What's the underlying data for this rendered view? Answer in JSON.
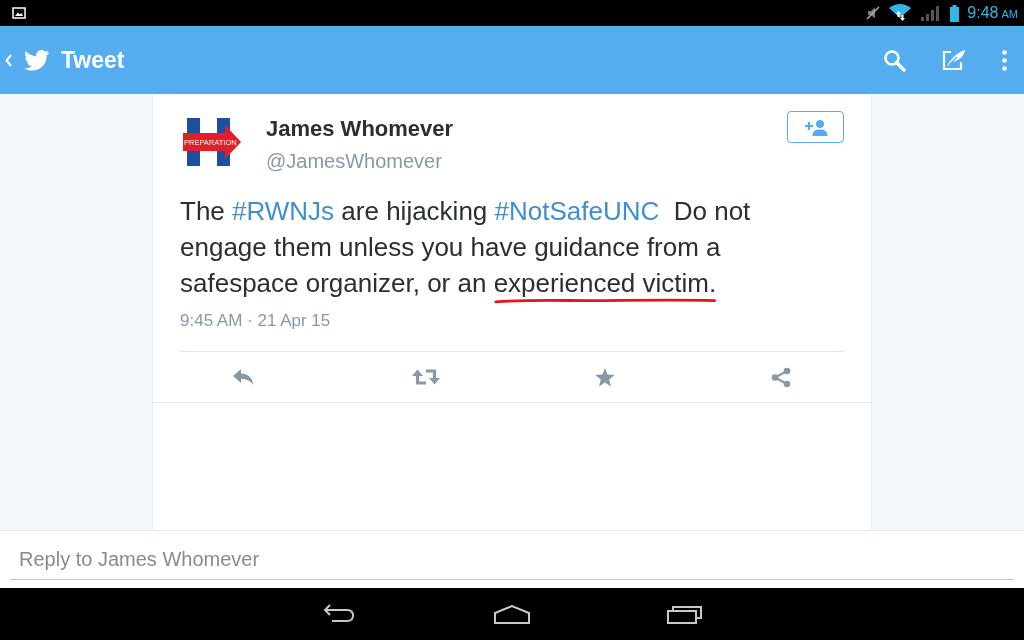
{
  "status_bar": {
    "time": "9:48",
    "period": "AM"
  },
  "app_bar": {
    "title": "Tweet"
  },
  "tweet": {
    "author": {
      "name": "James Whomever",
      "handle": "@JamesWhomever",
      "avatar_label": "PREPARATION"
    },
    "text": [
      {
        "kind": "plain",
        "text": "The "
      },
      {
        "kind": "hashtag",
        "text": "#RWNJs"
      },
      {
        "kind": "plain",
        "text": " are hijacking "
      },
      {
        "kind": "hashtag",
        "text": "#NotSafeUNC"
      },
      {
        "kind": "plain",
        "text": "  Do not engage them unless you have guidance from a safespace organizer, or an "
      },
      {
        "kind": "marked",
        "text": "experienced victim."
      }
    ],
    "timestamp": "9:45 AM · 21 Apr 15",
    "actions": [
      {
        "kind": "reply"
      },
      {
        "kind": "retweet"
      },
      {
        "kind": "favorite"
      },
      {
        "kind": "share"
      }
    ]
  },
  "reply": {
    "placeholder": "Reply to James Whomever"
  }
}
